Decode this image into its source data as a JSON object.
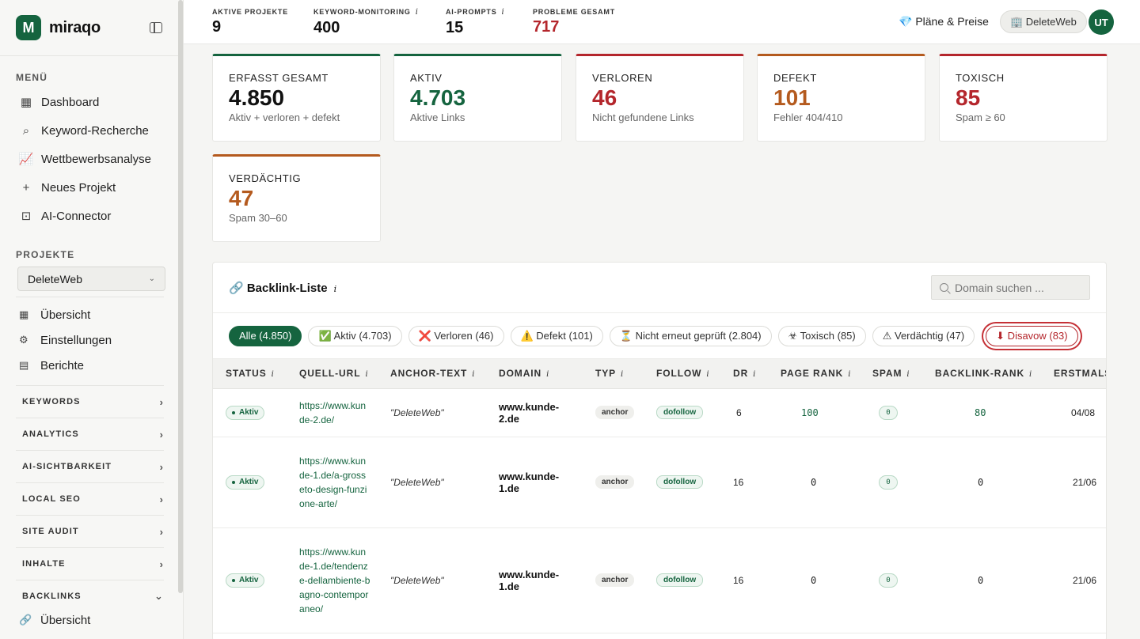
{
  "brand": {
    "name": "miraqo",
    "logo_letter": "M"
  },
  "sidebar": {
    "menu_title": "MENÜ",
    "menu": [
      {
        "label": "Dashboard",
        "icon": "grid-icon"
      },
      {
        "label": "Keyword-Recherche",
        "icon": "search-icon"
      },
      {
        "label": "Wettbewerbsanalyse",
        "icon": "chart-icon"
      },
      {
        "label": "Neues Projekt",
        "icon": "plus-icon"
      },
      {
        "label": "AI-Connector",
        "icon": "robot-icon"
      }
    ],
    "projects_title": "PROJEKTE",
    "project_selected": "DeleteWeb",
    "project_items": [
      {
        "label": "Übersicht",
        "icon": "grid-icon"
      },
      {
        "label": "Einstellungen",
        "icon": "gear-icon"
      },
      {
        "label": "Berichte",
        "icon": "document-icon"
      }
    ],
    "groups": [
      "KEYWORDS",
      "ANALYTICS",
      "AI-SICHTBARKEIT",
      "LOCAL SEO",
      "SITE AUDIT",
      "INHALTE",
      "BACKLINKS"
    ],
    "backlinks_sub": "Übersicht"
  },
  "topbar": {
    "stats": [
      {
        "label": "AKTIVE PROJEKTE",
        "value": "9",
        "info": false
      },
      {
        "label": "KEYWORD-MONITORING",
        "value": "400",
        "info": true
      },
      {
        "label": "AI-PROMPTS",
        "value": "15",
        "info": true
      },
      {
        "label": "PROBLEME GESAMT",
        "value": "717",
        "info": false
      }
    ],
    "plans": "💎 Pläne & Preise",
    "workspace": "🏢 DeleteWeb",
    "avatar": "UT"
  },
  "kpis": [
    {
      "title": "ERFASST GESAMT",
      "value": "4.850",
      "sub": "Aktiv + verloren + defekt",
      "color": "#15643f",
      "value_color": "#111111"
    },
    {
      "title": "AKTIV",
      "value": "4.703",
      "sub": "Aktive Links",
      "color": "#15643f",
      "value_color": "#15643f"
    },
    {
      "title": "VERLOREN",
      "value": "46",
      "sub": "Nicht gefundene Links",
      "color": "#b4262c",
      "value_color": "#b4262c"
    },
    {
      "title": "DEFEKT",
      "value": "101",
      "sub": "Fehler 404/410",
      "color": "#b45a1e",
      "value_color": "#b45a1e"
    },
    {
      "title": "TOXISCH",
      "value": "85",
      "sub": "Spam ≥ 60",
      "color": "#b4262c",
      "value_color": "#b4262c"
    },
    {
      "title": "VERDÄCHTIG",
      "value": "47",
      "sub": "Spam 30–60",
      "color": "#b45a1e",
      "value_color": "#b45a1e"
    }
  ],
  "backlinks": {
    "title": "🔗 Backlink-Liste",
    "search_placeholder": "Domain suchen ...",
    "filters": [
      "Alle (4.850)",
      "✅ Aktiv (4.703)",
      "❌ Verloren (46)",
      "⚠️ Defekt (101)",
      "⏳ Nicht erneut geprüft (2.804)",
      "☣ Toxisch (85)",
      "⚠ Verdächtig (47)",
      "⬇ Disavow (83)"
    ],
    "columns": [
      "STATUS",
      "QUELL-URL",
      "ANCHOR-TEXT",
      "DOMAIN",
      "TYP",
      "FOLLOW",
      "DR",
      "PAGE RANK",
      "SPAM",
      "BACKLINK-RANK",
      "ERSTMALS"
    ],
    "rows": [
      {
        "status": "Aktiv",
        "url": "https://www.kunde-2.de/",
        "anchor": "\"DeleteWeb\"",
        "domain": "www.kunde-2.de",
        "type": "anchor",
        "follow": "dofollow",
        "dr": "6",
        "page_rank": "100",
        "spam": "0",
        "backlink_rank": "80",
        "first": "04/08"
      },
      {
        "status": "Aktiv",
        "url": "https://www.kunde-1.de/a-grosseto-design-funzione-arte/",
        "anchor": "\"DeleteWeb\"",
        "domain": "www.kunde-1.de",
        "type": "anchor",
        "follow": "dofollow",
        "dr": "16",
        "page_rank": "0",
        "spam": "0",
        "backlink_rank": "0",
        "first": "21/06"
      },
      {
        "status": "Aktiv",
        "url": "https://www.kunde-1.de/tendenze-dellambiente-bagno-contemporaneo/",
        "anchor": "\"DeleteWeb\"",
        "domain": "www.kunde-1.de",
        "type": "anchor",
        "follow": "dofollow",
        "dr": "16",
        "page_rank": "0",
        "spam": "0",
        "backlink_rank": "0",
        "first": "21/06"
      }
    ]
  }
}
